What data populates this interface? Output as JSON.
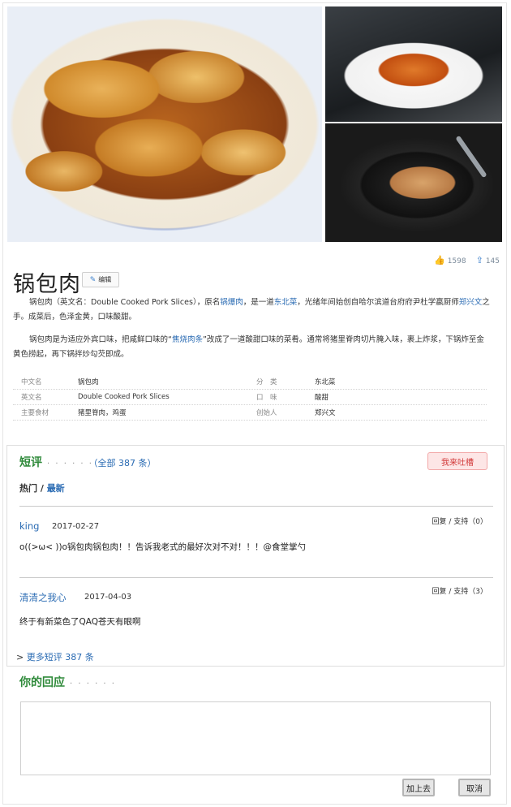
{
  "stats": {
    "likes": "1598",
    "shares": "145"
  },
  "title": "锅包肉",
  "edit_label": "编辑",
  "intro": {
    "p1_a": "锅包肉（英文名：Double Cooked Pork Slices），原名",
    "p1_link1": "锅爆肉",
    "p1_b": "，是一道",
    "p1_link2": "东北菜",
    "p1_c": "，光绪年间始创自哈尔滨道台府府尹杜学嬴厨师",
    "p1_link3": "郑兴文",
    "p1_d": "之手。成菜后，色泽金黄，口味酸甜。",
    "p2_a": "锅包肉是为适应外宾口味，把咸鲜口味的“",
    "p2_link": "焦烧肉条",
    "p2_b": "”改成了一道酸甜口味的菜肴。通常将猪里脊肉切片腌入味，裹上炸浆，下锅炸至金黄色捞起，再下锅拌炒勾芡即成。"
  },
  "info": [
    {
      "k1": "中文名",
      "v1": "锅包肉",
      "k2": "分　类",
      "v2": "东北菜"
    },
    {
      "k1": "英文名",
      "v1": "Double Cooked Pork Slices",
      "k2": "口　味",
      "v2": "酸甜"
    },
    {
      "k1": "主要食材",
      "v1": "猪里脊肉，鸡蛋",
      "k2": "创始人",
      "v2": "郑兴文"
    }
  ],
  "comments": {
    "heading": "短评",
    "dots": "· · · · · ·",
    "all_label": "（全部 387 条）",
    "rate_label": "我来吐槽",
    "sort_hot": "热门",
    "sort_sep": " / ",
    "sort_latest": "最新",
    "items": [
      {
        "user": "king",
        "date": "2017-02-27",
        "actions": "回复 / 支持（0）",
        "text": "o((>ω< ))o锅包肉锅包肉！！告诉我老式的最好次对不对！！！@食堂掌勺"
      },
      {
        "user": "清清之我心",
        "date": "2017-04-03",
        "actions": "回复 / 支持（3）",
        "text": "终于有新菜色了QAQ苍天有眼啊"
      }
    ],
    "more_arrow": ">",
    "more_label": " 更多短评 387 条"
  },
  "reply": {
    "heading": "你的回应",
    "dots": "· · · · · ·",
    "submit_label": "加上去",
    "cancel_label": "取消"
  },
  "colors": {
    "accent_green": "#2f8a3a",
    "link_blue": "#2a6bb3",
    "rate_red": "#d23a3a"
  },
  "icons": {
    "like": "thumbs-up-icon",
    "share": "share-icon",
    "edit": "pencil-icon"
  }
}
